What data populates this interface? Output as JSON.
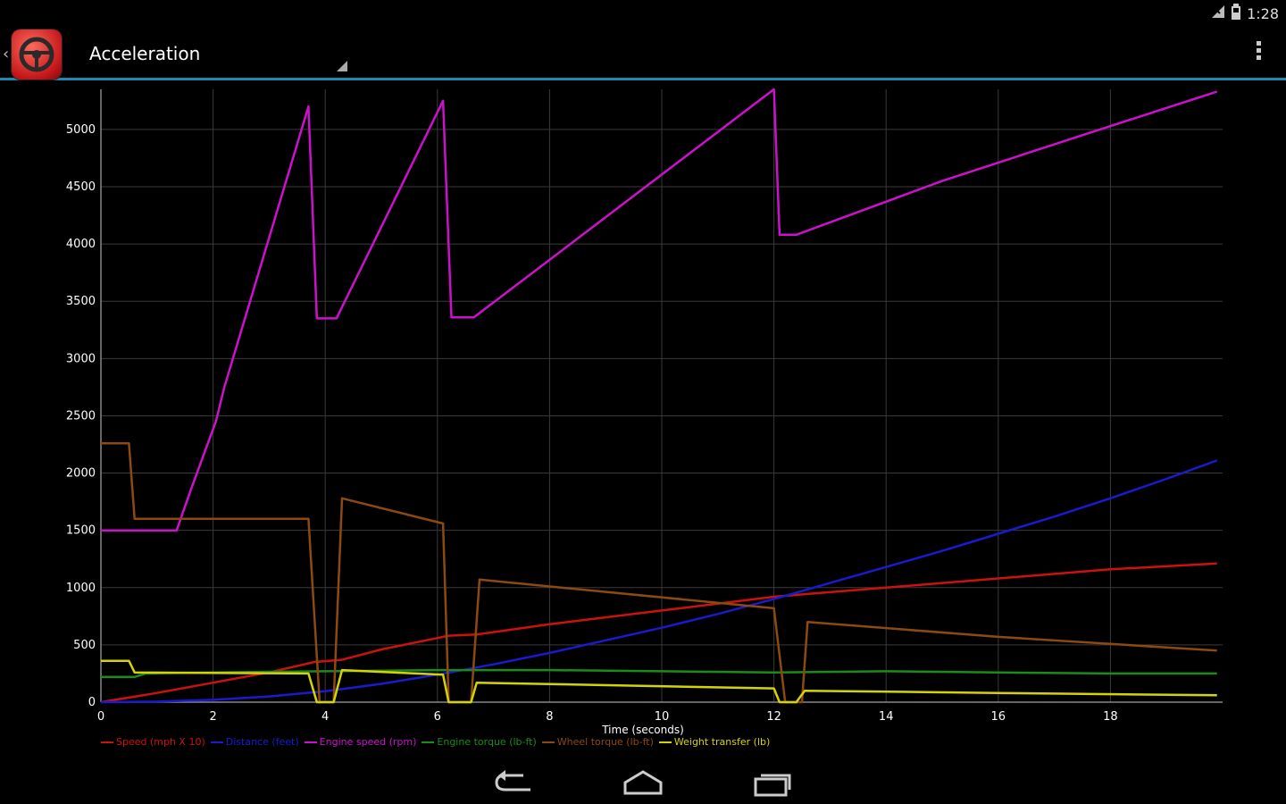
{
  "status_bar": {
    "time": "1:28",
    "icons": [
      "signal-icon",
      "battery-icon"
    ]
  },
  "action_bar": {
    "title": "Acceleration",
    "menu_icon": "overflow-menu-icon"
  },
  "nav_bar": {
    "icons": [
      "back-icon",
      "home-icon",
      "recents-icon"
    ]
  },
  "colors": {
    "accent": "#1d89b3",
    "grid": "#3a3a3a"
  },
  "chart_data": {
    "type": "line",
    "title": "",
    "xlabel": "Time (seconds)",
    "ylabel": "",
    "xlim": [
      0,
      20
    ],
    "ylim": [
      0,
      5350
    ],
    "x_ticks": [
      0,
      2,
      4,
      6,
      8,
      10,
      12,
      14,
      16,
      18
    ],
    "y_ticks": [
      0,
      500,
      1000,
      1500,
      2000,
      2500,
      3000,
      3500,
      4000,
      4500,
      5000
    ],
    "grid": true,
    "legend_position": "bottom",
    "series": [
      {
        "name": "Speed (mph X 10)",
        "color": "#cc1111",
        "points": [
          [
            0,
            0
          ],
          [
            1,
            80
          ],
          [
            2,
            170
          ],
          [
            3,
            260
          ],
          [
            3.8,
            350
          ],
          [
            4.3,
            370
          ],
          [
            5,
            460
          ],
          [
            6,
            560
          ],
          [
            6.2,
            580
          ],
          [
            6.7,
            590
          ],
          [
            8,
            680
          ],
          [
            10,
            800
          ],
          [
            12,
            920
          ],
          [
            14,
            1000
          ],
          [
            16,
            1080
          ],
          [
            18,
            1160
          ],
          [
            19.9,
            1210
          ]
        ]
      },
      {
        "name": "Distance (feet)",
        "color": "#1a1ad0",
        "points": [
          [
            0,
            0
          ],
          [
            1,
            5
          ],
          [
            2,
            20
          ],
          [
            3,
            50
          ],
          [
            4,
            95
          ],
          [
            5,
            160
          ],
          [
            6,
            240
          ],
          [
            7,
            330
          ],
          [
            8,
            430
          ],
          [
            9,
            540
          ],
          [
            10,
            650
          ],
          [
            11,
            770
          ],
          [
            12,
            900
          ],
          [
            13,
            1040
          ],
          [
            14,
            1180
          ],
          [
            15,
            1320
          ],
          [
            16,
            1470
          ],
          [
            17,
            1620
          ],
          [
            18,
            1780
          ],
          [
            19,
            1950
          ],
          [
            19.9,
            2110
          ]
        ]
      },
      {
        "name": "Engine speed (rpm)",
        "color": "#cc11cc",
        "points": [
          [
            0,
            1500
          ],
          [
            1.35,
            1500
          ],
          [
            1.6,
            1850
          ],
          [
            2.05,
            2450
          ],
          [
            2.2,
            2750
          ],
          [
            3.7,
            5200
          ],
          [
            3.85,
            3350
          ],
          [
            4.2,
            3350
          ],
          [
            6.1,
            5250
          ],
          [
            6.25,
            3360
          ],
          [
            6.65,
            3360
          ],
          [
            12,
            5350
          ],
          [
            12.1,
            4080
          ],
          [
            12.4,
            4080
          ],
          [
            15,
            4550
          ],
          [
            17.5,
            4950
          ],
          [
            19.9,
            5330
          ]
        ]
      },
      {
        "name": "Engine torque (lb-ft)",
        "color": "#1a8c1a",
        "points": [
          [
            0,
            220
          ],
          [
            0.6,
            220
          ],
          [
            0.8,
            250
          ],
          [
            2,
            260
          ],
          [
            4,
            270
          ],
          [
            6,
            280
          ],
          [
            8,
            280
          ],
          [
            10,
            270
          ],
          [
            12,
            260
          ],
          [
            14,
            270
          ],
          [
            16,
            260
          ],
          [
            18,
            250
          ],
          [
            19.9,
            250
          ]
        ]
      },
      {
        "name": "Wheel torque (lb-ft)",
        "color": "#8c4a10",
        "points": [
          [
            0,
            2260
          ],
          [
            0.5,
            2260
          ],
          [
            0.6,
            1600
          ],
          [
            3.7,
            1600
          ],
          [
            3.9,
            0
          ],
          [
            4.15,
            0
          ],
          [
            4.3,
            1780
          ],
          [
            6.1,
            1560
          ],
          [
            6.2,
            0
          ],
          [
            6.6,
            0
          ],
          [
            6.75,
            1070
          ],
          [
            12,
            820
          ],
          [
            12.2,
            0
          ],
          [
            12.5,
            0
          ],
          [
            12.6,
            700
          ],
          [
            16,
            570
          ],
          [
            19.9,
            450
          ]
        ]
      },
      {
        "name": "Weight transfer (lb)",
        "color": "#d4d400",
        "points": [
          [
            0,
            360
          ],
          [
            0.5,
            360
          ],
          [
            0.6,
            260
          ],
          [
            3.7,
            250
          ],
          [
            3.85,
            0
          ],
          [
            4.15,
            0
          ],
          [
            4.3,
            280
          ],
          [
            6.1,
            240
          ],
          [
            6.2,
            0
          ],
          [
            6.6,
            0
          ],
          [
            6.7,
            170
          ],
          [
            12,
            120
          ],
          [
            12.1,
            0
          ],
          [
            12.4,
            0
          ],
          [
            12.55,
            100
          ],
          [
            16,
            80
          ],
          [
            19.9,
            60
          ]
        ]
      }
    ]
  }
}
